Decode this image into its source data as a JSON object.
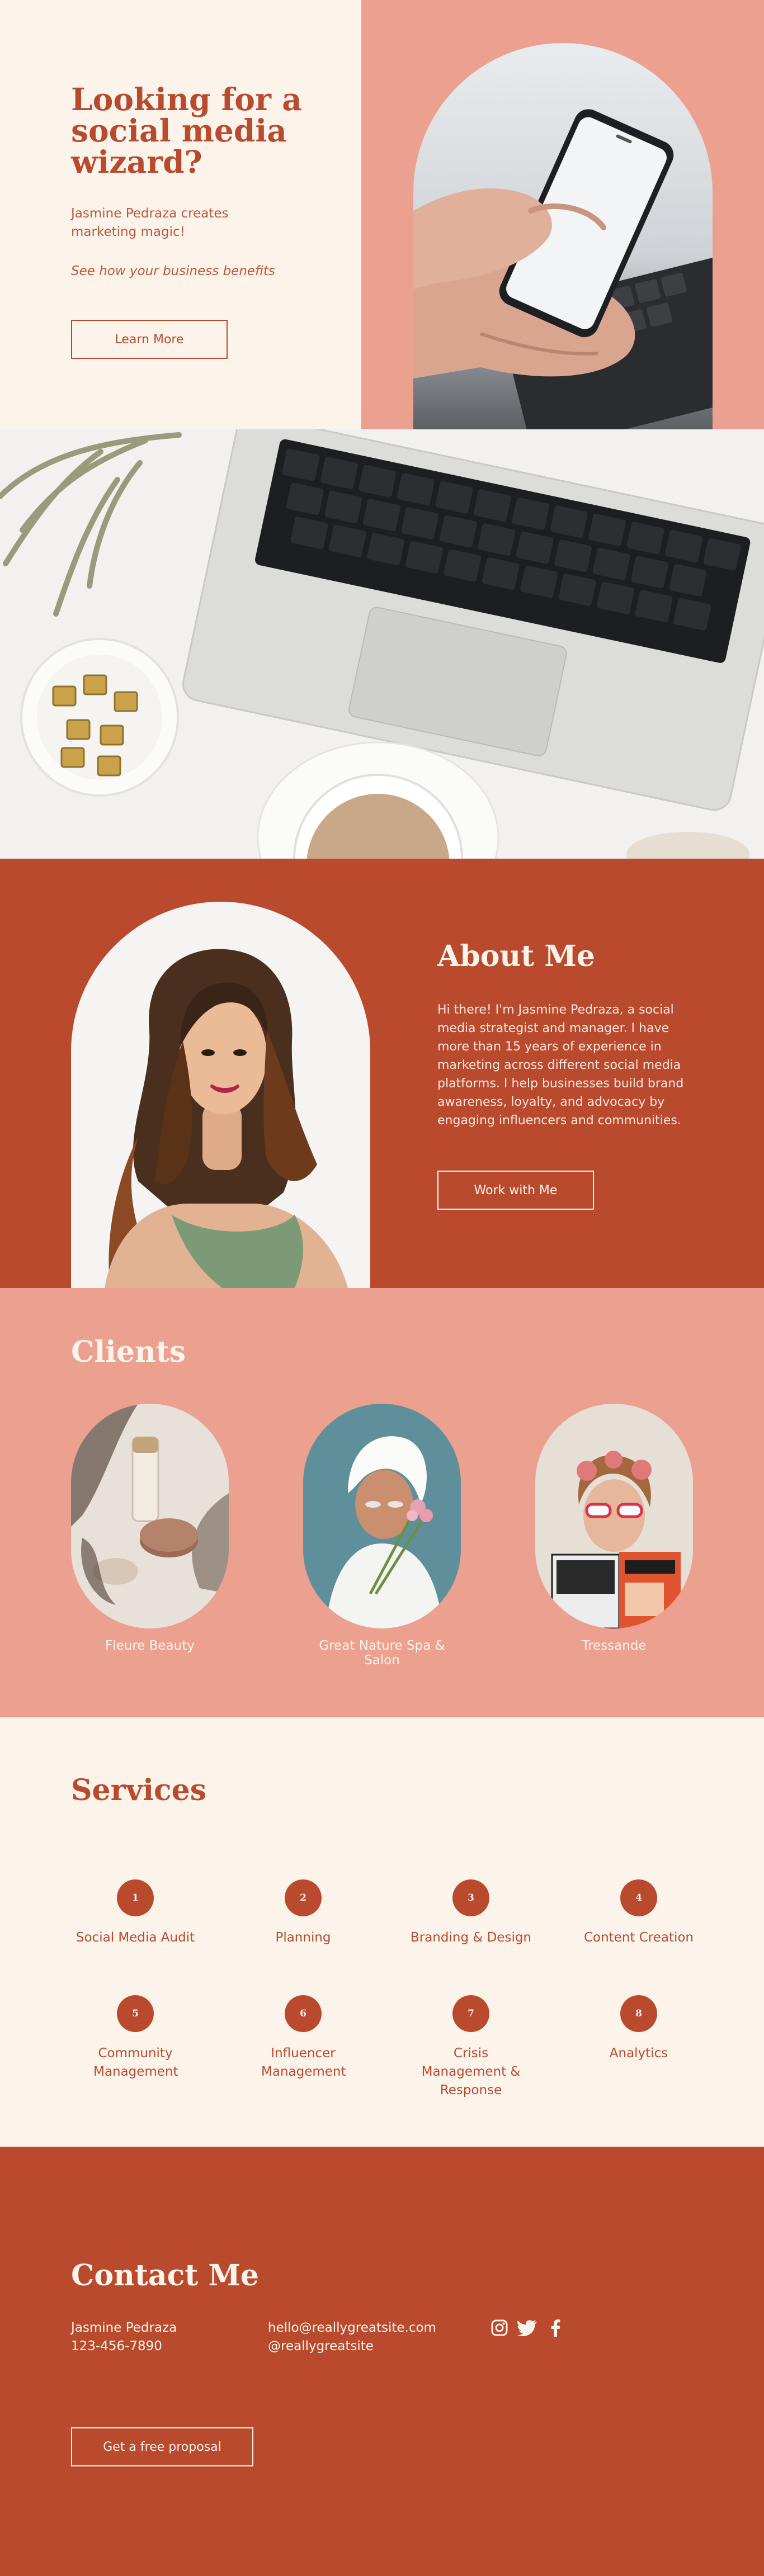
{
  "hero": {
    "title": "Looking for a social media wizard?",
    "subtitle": "Jasmine Pedraza creates marketing magic!",
    "benefits": "See how your business benefits",
    "button": "Learn More"
  },
  "about": {
    "title": "About Me",
    "body": "Hi there! I'm Jasmine Pedraza, a social media strategist and manager. I have more than 15 years of experience in marketing across different social media platforms. I help businesses build brand awareness, loyalty, and advocacy by engaging influencers and communities.",
    "button": "Work with Me"
  },
  "clients": {
    "title": "Clients",
    "items": [
      {
        "name": "Fleure Beauty"
      },
      {
        "name": "Great Nature Spa & Salon"
      },
      {
        "name": "Tressande"
      }
    ]
  },
  "services": {
    "title": "Services",
    "items": [
      {
        "num": "1",
        "label": "Social Media Audit"
      },
      {
        "num": "2",
        "label": "Planning"
      },
      {
        "num": "3",
        "label": "Branding & Design"
      },
      {
        "num": "4",
        "label": "Content Creation"
      },
      {
        "num": "5",
        "label": "Community Management"
      },
      {
        "num": "6",
        "label": "Influencer Management"
      },
      {
        "num": "7",
        "label": "Crisis Management & Response"
      },
      {
        "num": "8",
        "label": "Analytics"
      }
    ]
  },
  "contact": {
    "title": "Contact Me",
    "name": "Jasmine Pedraza",
    "phone": "123-456-7890",
    "email": "hello@reallygreatsite.com",
    "handle": "@reallygreatsite",
    "social_icons": [
      "instagram-icon",
      "twitter-icon",
      "facebook-icon"
    ],
    "button": "Get a free proposal"
  },
  "colors": {
    "rust": "#b94a2e",
    "salmon": "#eca190",
    "cream": "#fcf4ea"
  }
}
